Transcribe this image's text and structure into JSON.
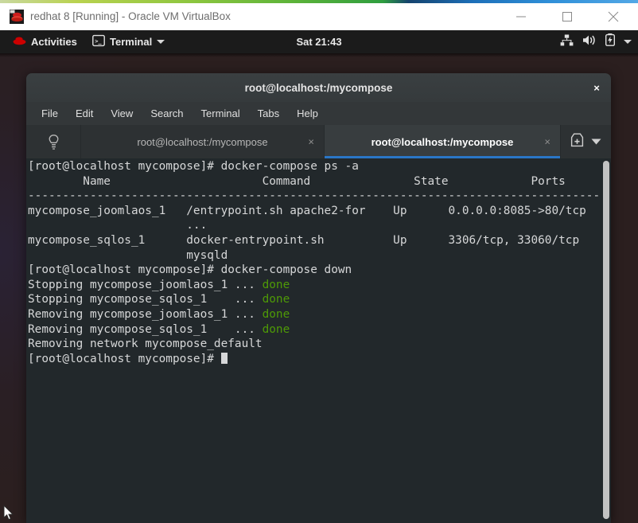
{
  "vbox": {
    "title": "redhat 8 [Running] - Oracle VM VirtualBox",
    "icon": "virtualbox-redhat-icon",
    "buttons": {
      "minimize": "minimize-button",
      "maximize": "maximize-button",
      "close": "close-button"
    }
  },
  "gnome_topbar": {
    "activities": "Activities",
    "app_menu": "Terminal",
    "clock": "Sat 21:43",
    "status_icons": [
      "network-wired-icon",
      "volume-icon",
      "battery-charging-icon",
      "chevron-down-icon"
    ]
  },
  "terminal_window": {
    "title": "root@localhost:/mycompose",
    "close_label": "×",
    "menubar": [
      "File",
      "Edit",
      "View",
      "Search",
      "Terminal",
      "Tabs",
      "Help"
    ],
    "tabs": [
      {
        "label": "root@localhost:/mycompose",
        "active": false,
        "close": "×"
      },
      {
        "label": "root@localhost:/mycompose",
        "active": true,
        "close": "×"
      }
    ],
    "tab_actions": [
      "new-tab-icon",
      "tab-list-chevron-icon"
    ],
    "hint_icon": "lightbulb-icon"
  },
  "console": {
    "prompt": "[root@localhost mycompose]#",
    "lines": [
      {
        "segments": [
          {
            "t": "[root@localhost mycompose]# docker-compose ps -a",
            "c": "fg"
          }
        ]
      },
      {
        "segments": [
          {
            "t": "        Name                      Command               State            Ports        ",
            "c": "fg"
          }
        ]
      },
      {
        "segments": [
          {
            "t": "-------------------------------------------------------------------------------------",
            "c": "fg"
          }
        ]
      },
      {
        "segments": [
          {
            "t": "mycompose_joomlaos_1   /entrypoint.sh apache2-for    Up      0.0.0.0:8085->80/tcp",
            "c": "fg"
          }
        ]
      },
      {
        "segments": [
          {
            "t": "                       ...                                                      ",
            "c": "fg"
          }
        ]
      },
      {
        "segments": [
          {
            "t": "mycompose_sqlos_1      docker-entrypoint.sh          Up      3306/tcp, 33060/tcp ",
            "c": "fg"
          }
        ]
      },
      {
        "segments": [
          {
            "t": "                       mysqld                                                   ",
            "c": "fg"
          }
        ]
      },
      {
        "segments": [
          {
            "t": "[root@localhost mycompose]# docker-compose down",
            "c": "fg"
          }
        ]
      },
      {
        "segments": [
          {
            "t": "Stopping mycompose_joomlaos_1 ... ",
            "c": "fg"
          },
          {
            "t": "done",
            "c": "green"
          }
        ]
      },
      {
        "segments": [
          {
            "t": "Stopping mycompose_sqlos_1    ... ",
            "c": "fg"
          },
          {
            "t": "done",
            "c": "green"
          }
        ]
      },
      {
        "segments": [
          {
            "t": "Removing mycompose_joomlaos_1 ... ",
            "c": "fg"
          },
          {
            "t": "done",
            "c": "green"
          }
        ]
      },
      {
        "segments": [
          {
            "t": "Removing mycompose_sqlos_1    ... ",
            "c": "fg"
          },
          {
            "t": "done",
            "c": "green"
          }
        ]
      },
      {
        "segments": [
          {
            "t": "Removing network mycompose_default",
            "c": "fg"
          }
        ]
      },
      {
        "segments": [
          {
            "t": "[root@localhost mycompose]# ",
            "c": "fg"
          },
          {
            "t": "",
            "c": "cursor"
          }
        ]
      }
    ]
  },
  "colors": {
    "terminal_bg": "#22282b",
    "terminal_fg": "#d6d7d8",
    "green": "#4e9a06",
    "tab_accent": "#2a76c6",
    "titlebar": "#363b3d"
  },
  "pointer": {
    "name": "mouse-pointer"
  }
}
